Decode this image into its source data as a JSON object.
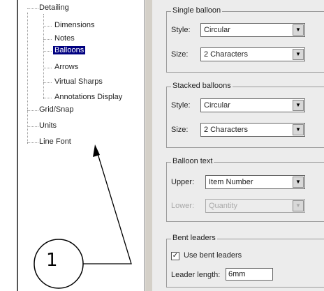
{
  "tree": {
    "items": [
      {
        "label": "Detailing"
      },
      {
        "label": "Dimensions"
      },
      {
        "label": "Notes"
      },
      {
        "label": "Balloons"
      },
      {
        "label": "Arrows"
      },
      {
        "label": "Virtual Sharps"
      },
      {
        "label": "Annotations Display"
      },
      {
        "label": "Grid/Snap"
      },
      {
        "label": "Units"
      },
      {
        "label": "Line Font"
      }
    ],
    "selected": "Balloons"
  },
  "single_balloon": {
    "title": "Single balloon",
    "style_label": "Style:",
    "style_value": "Circular",
    "size_label": "Size:",
    "size_value": "2 Characters"
  },
  "stacked_balloons": {
    "title": "Stacked balloons",
    "style_label": "Style:",
    "style_value": "Circular",
    "size_label": "Size:",
    "size_value": "2 Characters"
  },
  "balloon_text": {
    "title": "Balloon text",
    "upper_label": "Upper:",
    "upper_value": "Item Number",
    "lower_label": "Lower:",
    "lower_value": "Quantity"
  },
  "bent_leaders": {
    "title": "Bent leaders",
    "checkbox_label": "Use bent leaders",
    "checked": true,
    "leader_length_label": "Leader length:",
    "leader_length_value": "6mm"
  },
  "callout": {
    "number": "1"
  }
}
